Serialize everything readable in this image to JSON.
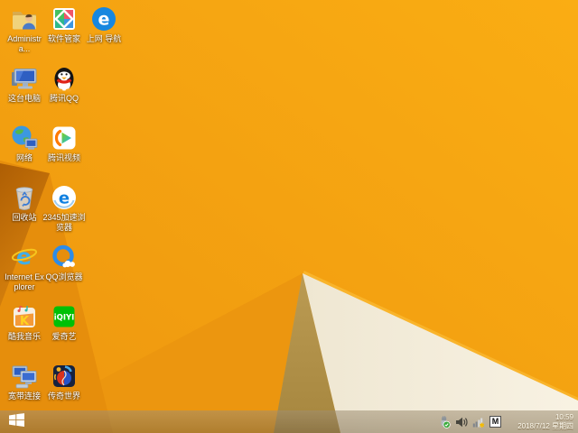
{
  "wallpaper": {
    "base_top": "#FAAD13",
    "base_bottom": "#EE970F",
    "left_shade": "#E68E0C",
    "bottom_shade": "#EC960F",
    "rust_dark": "#AE5E04",
    "rust_light": "#D8830E",
    "tan_top": "#BB9B53",
    "tan_bottom": "#A6863E",
    "cream_left": "#EFE7D2",
    "cream_right": "#F8F2E3",
    "ridge": "#F9B42B"
  },
  "glyphs": {
    "e_nav": "e",
    "e_2345": "e",
    "e_ie": "e",
    "kuwo_k": "K",
    "iqiyi": "iQIYI"
  },
  "desktop": {
    "icons": [
      {
        "label": "Administra...",
        "name": "administrator"
      },
      {
        "label": "软件管家",
        "name": "software-manager"
      },
      {
        "label": "上网 导航",
        "name": "web-navigation"
      },
      {
        "label": "这台电脑",
        "name": "this-pc"
      },
      {
        "label": "腾讯QQ",
        "name": "tencent-qq"
      },
      {
        "label": "网络",
        "name": "network"
      },
      {
        "label": "腾讯视频",
        "name": "tencent-video"
      },
      {
        "label": "回收站",
        "name": "recycle-bin"
      },
      {
        "label": "2345加速浏览器",
        "name": "2345-browser"
      },
      {
        "label": "Internet Explorer",
        "name": "internet-explorer"
      },
      {
        "label": "QQ浏览器",
        "name": "qq-browser"
      },
      {
        "label": "酷我音乐",
        "name": "kuwo-music"
      },
      {
        "label": "爱奇艺",
        "name": "iqiyi"
      },
      {
        "label": "宽带连接",
        "name": "broadband-connection"
      },
      {
        "label": "传奇世界",
        "name": "legend-world"
      }
    ]
  },
  "taskbar": {
    "ime_indicator": "M",
    "clock": {
      "time": "10:59",
      "date": "2018/7/12 星期四"
    }
  }
}
